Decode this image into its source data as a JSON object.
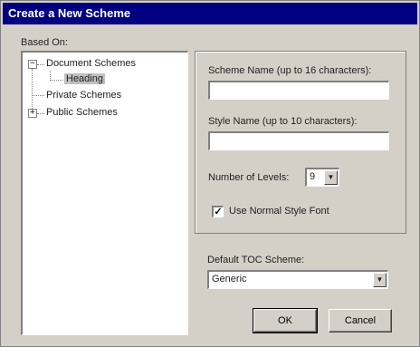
{
  "dialog": {
    "title": "Create a New Scheme"
  },
  "based_on": {
    "label": "Based On:",
    "tree": {
      "document_schemes": "Document Schemes",
      "heading": "Heading",
      "private_schemes": "Private Schemes",
      "public_schemes": "Public Schemes"
    }
  },
  "scheme_name": {
    "label": "Scheme Name (up to 16 characters):",
    "value": ""
  },
  "style_name": {
    "label": "Style Name (up to 10 characters):",
    "value": ""
  },
  "levels": {
    "label": "Number of Levels:",
    "value": "9"
  },
  "use_normal_font": {
    "label": "Use Normal Style Font",
    "checked": true,
    "mark": "✓"
  },
  "default_toc": {
    "label": "Default TOC Scheme:",
    "value": "Generic"
  },
  "buttons": {
    "ok": "OK",
    "cancel": "Cancel"
  },
  "glyphs": {
    "minus": "−",
    "plus": "+",
    "arrow_down": "▼"
  }
}
